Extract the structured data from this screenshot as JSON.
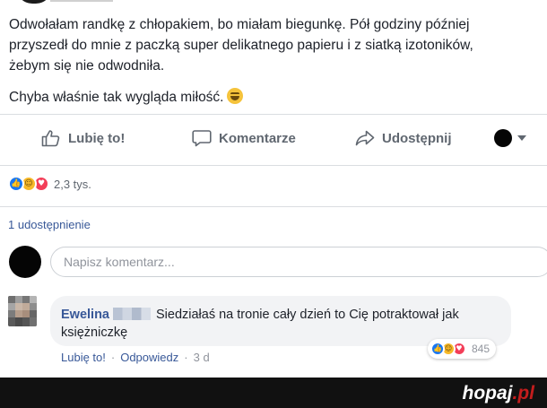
{
  "post": {
    "line1": "Odwołałam randkę z chłopakiem, bo miałam biegunkę. Pół godziny później",
    "line2": "przyszedł do mnie z paczką super delikatnego papieru i z siatką izotoników,",
    "line3": "żebym się nie odwodniła.",
    "line4": "Chyba właśnie tak wygląda miłość.",
    "emoji_icon": "grinning-face-icon"
  },
  "actions": {
    "like_label": "Lubię to!",
    "comment_label": "Komentarze",
    "share_label": "Udostępnij",
    "like_icon": "thumbs-up-icon",
    "comment_icon": "speech-bubble-icon",
    "share_icon": "share-arrow-icon",
    "audience_icon": "audience-avatar-icon"
  },
  "reactions": {
    "icons": [
      "like-reaction-icon",
      "haha-reaction-icon",
      "love-reaction-icon"
    ],
    "count": "2,3 tys."
  },
  "shares": {
    "label": "1 udostępnienie"
  },
  "composer": {
    "placeholder": "Napisz komentarz..."
  },
  "comment": {
    "author": "Ewelina",
    "text_line1": "Siedziałaś na tronie cały dzień to Cię potraktował jak",
    "text_line2": "księżniczkę",
    "reaction_count": "845",
    "like_label": "Lubię to!",
    "reply_label": "Odpowiedz",
    "separator": "·",
    "time": "3 d"
  },
  "footer": {
    "brand_main": "hopaj",
    "brand_suffix": ".pl"
  },
  "colors": {
    "link": "#385898",
    "muted": "#606770",
    "like": "#1877f2",
    "haha": "#f7b928",
    "love": "#f33e58"
  }
}
